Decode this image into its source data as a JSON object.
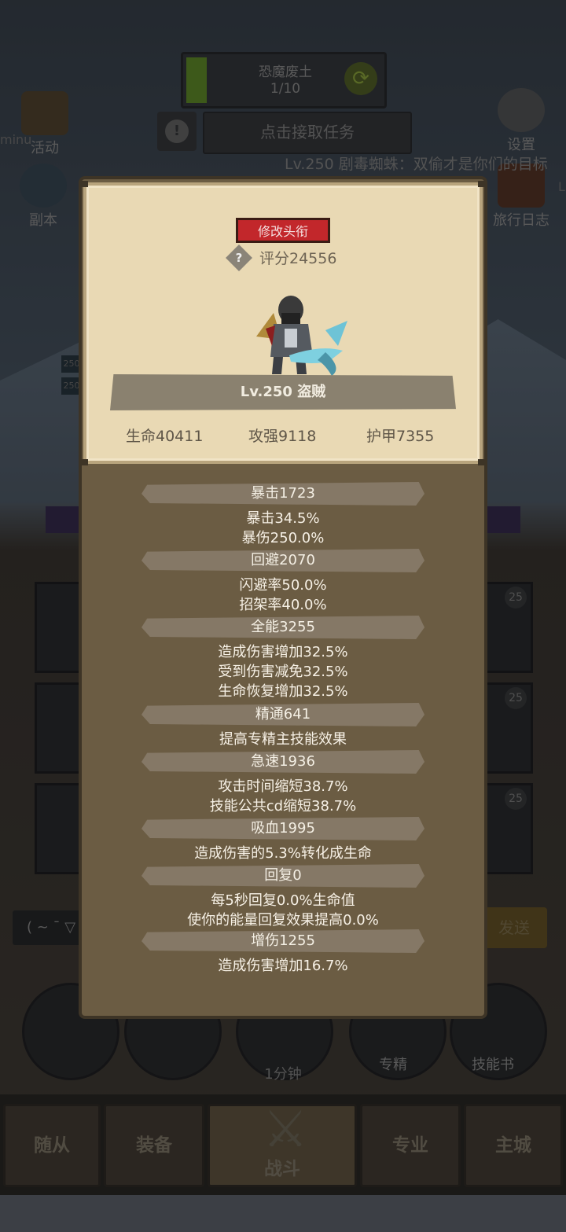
{
  "quest": {
    "name": "恐魔废土",
    "progress": "1/10",
    "progress_fraction": 0.1,
    "accept_label": "点击接取任务"
  },
  "side_left": {
    "activity": "活动",
    "dungeon": "副本",
    "edge_text": "minu"
  },
  "side_right": {
    "settings": "设置",
    "journal": "旅行日志",
    "edge_text": "L"
  },
  "marquee": "Lv.250 剧毒蜘蛛：双偷才是你们的目标",
  "bg_levels": [
    "250",
    "250"
  ],
  "bg_badges": [
    "25",
    "25",
    "25"
  ],
  "chat": {
    "emote": "( ~ ¯ ▽",
    "send_label": "发送"
  },
  "bottom_round": {
    "timer": "1分钟",
    "specialize": "专精",
    "skill_book": "技能书"
  },
  "nav": {
    "followers": "随从",
    "equipment": "装备",
    "battle": "战斗",
    "profession": "专业",
    "city": "主城"
  },
  "card": {
    "title_button": "修改头衔",
    "score": "评分24556",
    "level_class": "Lv.250 盗贼",
    "hp": "生命40411",
    "attack": "攻强9118",
    "armor": "护甲7355"
  },
  "stats": [
    {
      "head": "暴击1723",
      "lines": [
        "暴击34.5%",
        "暴伤250.0%"
      ]
    },
    {
      "head": "回避2070",
      "lines": [
        "闪避率50.0%",
        "招架率40.0%"
      ]
    },
    {
      "head": "全能3255",
      "lines": [
        "造成伤害增加32.5%",
        "受到伤害减免32.5%",
        "生命恢复增加32.5%"
      ]
    },
    {
      "head": "精通641",
      "lines": [
        "提高专精主技能效果"
      ]
    },
    {
      "head": "急速1936",
      "lines": [
        "攻击时间缩短38.7%",
        "技能公共cd缩短38.7%"
      ]
    },
    {
      "head": "吸血1995",
      "lines": [
        "造成伤害的5.3%转化成生命"
      ]
    },
    {
      "head": "回复0",
      "lines": [
        "每5秒回复0.0%生命值",
        "使你的能量回复效果提高0.0%"
      ]
    },
    {
      "head": "增伤1255",
      "lines": [
        "造成伤害增加16.7%"
      ]
    }
  ],
  "colors": {
    "panel": "#6b5c43",
    "card": "#e9d9b4",
    "title_button": "#c2272b",
    "quest_fill": "#6a9a2e"
  }
}
